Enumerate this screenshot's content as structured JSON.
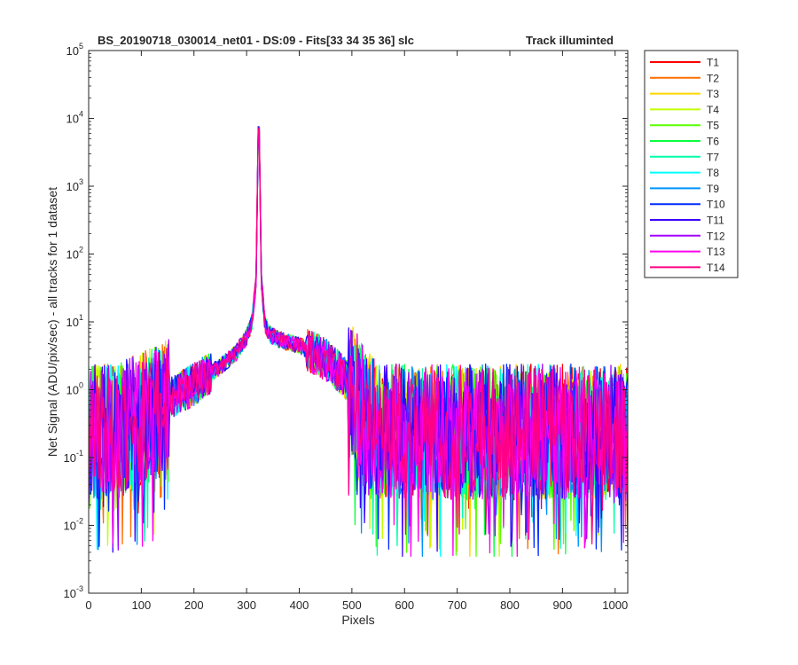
{
  "chart_data": {
    "type": "line",
    "title_left": "BS_20190718_030014_net01 - DS:09 - Fits[33  34  35  36]   slc",
    "title_right": "Track illuminted",
    "xlabel": "Pixels",
    "ylabel": "Net Signal (ADU/pix/sec) - all tracks for 1 dataset",
    "xlim": [
      0,
      1024
    ],
    "ylim": [
      0.001,
      100000
    ],
    "yscale": "log",
    "grid": false,
    "legend_position": "outside-right",
    "x_ticks": [
      0,
      100,
      200,
      300,
      400,
      500,
      600,
      700,
      800,
      900,
      1000
    ],
    "y_ticks": [
      {
        "value": 0.001,
        "base": "10",
        "exp": "-3"
      },
      {
        "value": 0.01,
        "base": "10",
        "exp": "-2"
      },
      {
        "value": 0.1,
        "base": "10",
        "exp": "-1"
      },
      {
        "value": 1,
        "base": "10",
        "exp": "0"
      },
      {
        "value": 10,
        "base": "10",
        "exp": "1"
      },
      {
        "value": 100,
        "base": "10",
        "exp": "2"
      },
      {
        "value": 1000,
        "base": "10",
        "exp": "3"
      },
      {
        "value": 10000,
        "base": "10",
        "exp": "4"
      },
      {
        "value": 100000,
        "base": "10",
        "exp": "5"
      }
    ],
    "profile": {
      "x": [
        0,
        50,
        100,
        150,
        200,
        250,
        280,
        300,
        310,
        318,
        323,
        328,
        335,
        345,
        360,
        400,
        450,
        500,
        520,
        550,
        600,
        700,
        800,
        900,
        1024
      ],
      "y": [
        0.3,
        0.3,
        0.45,
        0.7,
        1.2,
        2.2,
        3.5,
        6,
        10,
        40,
        20000,
        40,
        9,
        6.5,
        5.5,
        4.5,
        2.8,
        1.2,
        0.6,
        0.3,
        0.3,
        0.3,
        0.3,
        0.3,
        0.3
      ]
    },
    "series": [
      {
        "name": "T1",
        "color": "#ff0000"
      },
      {
        "name": "T2",
        "color": "#ff6e00"
      },
      {
        "name": "T3",
        "color": "#ffd600"
      },
      {
        "name": "T4",
        "color": "#c2ff00"
      },
      {
        "name": "T5",
        "color": "#5aff00"
      },
      {
        "name": "T6",
        "color": "#0dff40"
      },
      {
        "name": "T7",
        "color": "#00ffa8"
      },
      {
        "name": "T8",
        "color": "#00ffff"
      },
      {
        "name": "T9",
        "color": "#0094ff"
      },
      {
        "name": "T10",
        "color": "#002cff"
      },
      {
        "name": "T11",
        "color": "#3c00ff"
      },
      {
        "name": "T12",
        "color": "#a300ff"
      },
      {
        "name": "T13",
        "color": "#ff00ee"
      },
      {
        "name": "T14",
        "color": "#ff0086"
      }
    ]
  }
}
